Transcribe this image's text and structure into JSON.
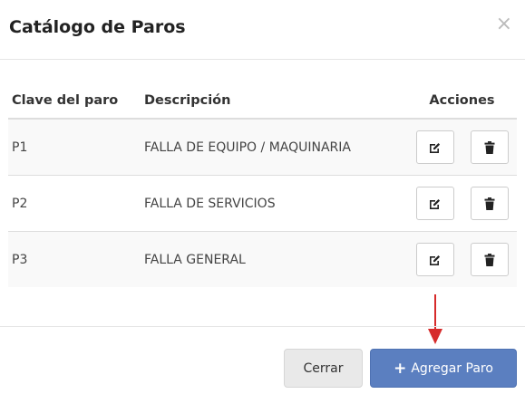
{
  "modal": {
    "title": "Catálogo de Paros",
    "close_label": "×"
  },
  "table": {
    "headers": {
      "code": "Clave del paro",
      "description": "Descripción",
      "actions": "Acciones"
    },
    "rows": [
      {
        "code": "P1",
        "description": "FALLA DE EQUIPO / MAQUINARIA"
      },
      {
        "code": "P2",
        "description": "FALLA DE SERVICIOS"
      },
      {
        "code": "P3",
        "description": "FALLA GENERAL"
      }
    ],
    "row_icons": [
      "edit-icon",
      "trash-icon"
    ]
  },
  "footer": {
    "close_button": "Cerrar",
    "add_button": "Agregar Paro",
    "add_icon": "plus-icon"
  },
  "colors": {
    "primary": "#5b7fc0",
    "annotation_arrow": "#d62b2b",
    "stripe": "#f9f9f9"
  }
}
